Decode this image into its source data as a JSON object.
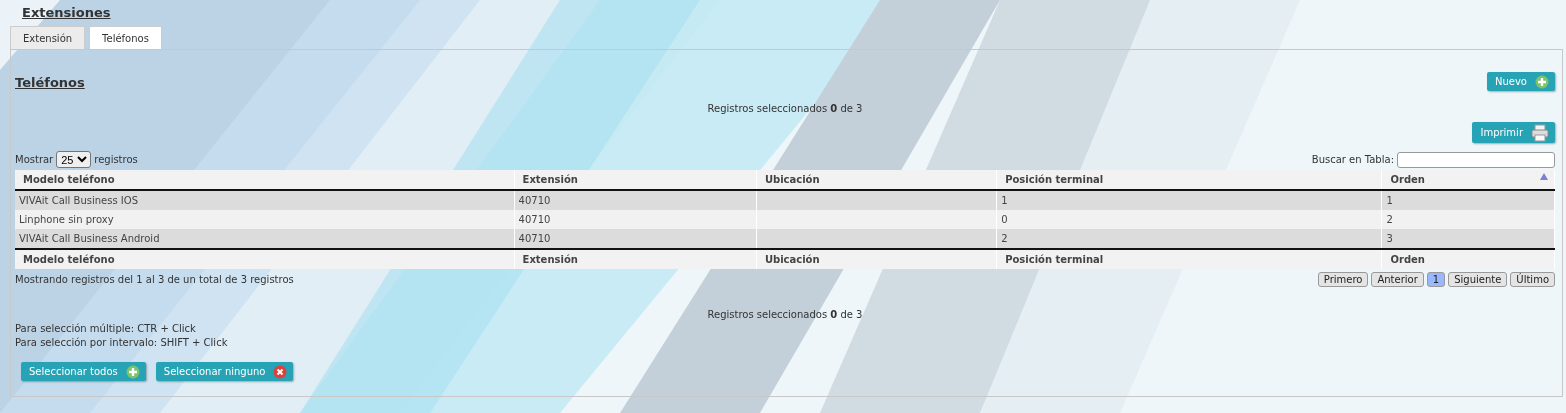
{
  "page_title": "Extensiones",
  "tabs": [
    {
      "label": "Extensión",
      "selected": false
    },
    {
      "label": "Teléfonos",
      "selected": true
    }
  ],
  "section_title": "Teléfonos",
  "new_button": "Nuevo",
  "selected_summary_top": "Registros seleccionados **0** de 3",
  "print_button": "Imprimir",
  "page_size": {
    "prefix": "Mostrar",
    "value": "25",
    "suffix": "registros"
  },
  "search": {
    "label": "Buscar en Tabla:"
  },
  "table": {
    "columns": [
      {
        "label": "Modelo teléfono",
        "sorted": false
      },
      {
        "label": "Extensión",
        "sorted": false
      },
      {
        "label": "Ubicación",
        "sorted": false
      },
      {
        "label": "Posición terminal",
        "sorted": false
      },
      {
        "label": "Orden",
        "sorted": true
      }
    ],
    "rows": [
      [
        "VIVAit Call Business IOS",
        "40710",
        "",
        "1",
        "1"
      ],
      [
        "Linphone sin proxy",
        "40710",
        "",
        "0",
        "2"
      ],
      [
        "VIVAit Call Business Android",
        "40710",
        "",
        "2",
        "3"
      ]
    ],
    "footer": [
      "Modelo teléfono",
      "Extensión",
      "Ubicación",
      "Posición terminal",
      "Orden"
    ]
  },
  "info": "Mostrando registros del 1 al 3 de un total de 3 registros",
  "pagination": [
    {
      "label": "Primero",
      "selected": false
    },
    {
      "label": "Anterior",
      "selected": false
    },
    {
      "label": "1",
      "selected": true
    },
    {
      "label": "Siguiente",
      "selected": false
    },
    {
      "label": "Último",
      "selected": false
    }
  ],
  "selected_summary_bottom": "Registros seleccionados **0** de 3",
  "hints": [
    "Para selección múltiple: CTR + Click",
    "Para selección por intervalo: SHIFT + Click"
  ],
  "select_buttons": [
    {
      "label": "Seleccionar todos",
      "kind": "add"
    },
    {
      "label": "Seleccionar ninguno",
      "kind": "remove"
    }
  ]
}
